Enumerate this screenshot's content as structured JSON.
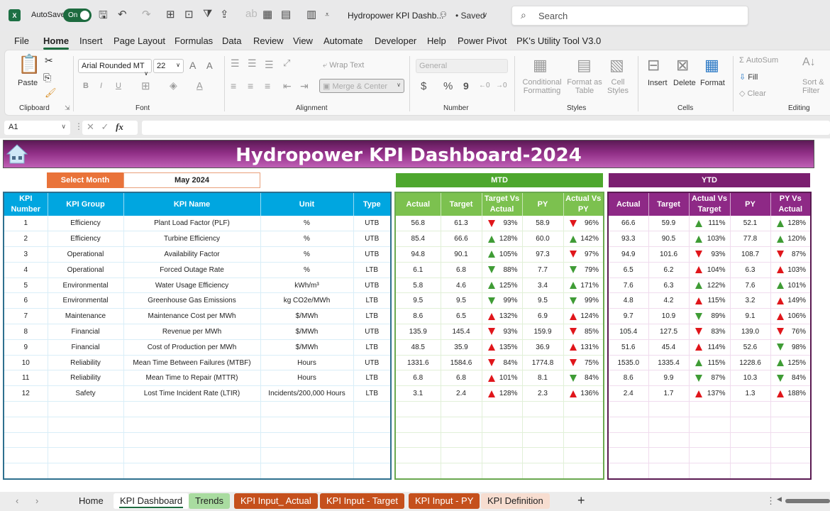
{
  "titlebar": {
    "app_icon": "excel-icon",
    "autosave_label": "AutoSave",
    "autosave_state": "On",
    "doc_title": "Hydropower KPI Dashb...",
    "saved_status": "• Saved",
    "search_placeholder": "Search"
  },
  "menu": [
    "File",
    "Home",
    "Insert",
    "Page Layout",
    "Formulas",
    "Data",
    "Review",
    "View",
    "Automate",
    "Developer",
    "Help",
    "Power Pivot",
    "PK's Utility Tool V3.0"
  ],
  "menu_active": "Home",
  "ribbon": {
    "clipboard": {
      "paste": "Paste",
      "label": "Clipboard"
    },
    "font": {
      "name": "Arial Rounded MT",
      "size": "22",
      "bold": "B",
      "italic": "I",
      "underline": "U",
      "label": "Font"
    },
    "alignment": {
      "wrap": "Wrap Text",
      "merge": "Merge & Center",
      "label": "Alignment"
    },
    "number": {
      "format": "General",
      "currency": "$",
      "percent": "%",
      "comma": "9",
      "label": "Number"
    },
    "styles": {
      "conditional": "Conditional",
      "conditional2": "Formatting",
      "format_table": "Format as",
      "format_table2": "Table",
      "cell_styles": "Cell",
      "cell_styles2": "Styles",
      "label": "Styles"
    },
    "cells": {
      "insert": "Insert",
      "delete": "Delete",
      "format": "Format",
      "label": "Cells"
    },
    "editing": {
      "autosum": "AutoSum",
      "fill": "Fill",
      "clear": "Clear",
      "sort": "Sort &",
      "sort2": "Filter",
      "label": "Editing"
    }
  },
  "formula_bar": {
    "name_box": "A1",
    "fx": "fx",
    "value": ""
  },
  "dashboard": {
    "title": "Hydropower KPI Dashboard-2024",
    "select_month_label": "Select Month",
    "select_month_value": "May 2024",
    "mtd_label": "MTD",
    "ytd_label": "YTD",
    "kpi_headers": [
      "KPI Number",
      "KPI Group",
      "KPI Name",
      "Unit",
      "Type"
    ],
    "mtd_headers": [
      "Actual",
      "Target",
      "Target Vs Actual",
      "PY",
      "Actual Vs PY"
    ],
    "ytd_headers": [
      "Actual",
      "Target",
      "Actual Vs Target",
      "PY",
      "PY Vs Actual"
    ],
    "colors": {
      "good": "#3f9c35",
      "bad": "#e0161b"
    },
    "rows": [
      {
        "num": "1",
        "group": "Efficiency",
        "name": "Plant Load Factor (PLF)",
        "unit": "%",
        "type": "UTB",
        "mtd": {
          "actual": "56.8",
          "target": "61.3",
          "tva": "93%",
          "tva_dir": "down",
          "tva_status": "bad",
          "py": "58.9",
          "avp": "96%",
          "avp_dir": "down",
          "avp_status": "bad"
        },
        "ytd": {
          "actual": "66.6",
          "target": "59.9",
          "avt": "111%",
          "avt_dir": "up",
          "avt_status": "good",
          "py": "52.1",
          "pva": "128%",
          "pva_dir": "up",
          "pva_status": "good"
        }
      },
      {
        "num": "2",
        "group": "Efficiency",
        "name": "Turbine Efficiency",
        "unit": "%",
        "type": "UTB",
        "mtd": {
          "actual": "85.4",
          "target": "66.6",
          "tva": "128%",
          "tva_dir": "up",
          "tva_status": "good",
          "py": "60.0",
          "avp": "142%",
          "avp_dir": "up",
          "avp_status": "good"
        },
        "ytd": {
          "actual": "93.3",
          "target": "90.5",
          "avt": "103%",
          "avt_dir": "up",
          "avt_status": "good",
          "py": "77.8",
          "pva": "120%",
          "pva_dir": "up",
          "pva_status": "good"
        }
      },
      {
        "num": "3",
        "group": "Operational",
        "name": "Availability Factor",
        "unit": "%",
        "type": "UTB",
        "mtd": {
          "actual": "94.8",
          "target": "90.1",
          "tva": "105%",
          "tva_dir": "up",
          "tva_status": "good",
          "py": "97.3",
          "avp": "97%",
          "avp_dir": "down",
          "avp_status": "bad"
        },
        "ytd": {
          "actual": "94.9",
          "target": "101.6",
          "avt": "93%",
          "avt_dir": "down",
          "avt_status": "bad",
          "py": "108.7",
          "pva": "87%",
          "pva_dir": "down",
          "pva_status": "bad"
        }
      },
      {
        "num": "4",
        "group": "Operational",
        "name": "Forced Outage Rate",
        "unit": "%",
        "type": "LTB",
        "mtd": {
          "actual": "6.1",
          "target": "6.8",
          "tva": "88%",
          "tva_dir": "down",
          "tva_status": "good",
          "py": "7.7",
          "avp": "79%",
          "avp_dir": "down",
          "avp_status": "good"
        },
        "ytd": {
          "actual": "6.5",
          "target": "6.2",
          "avt": "104%",
          "avt_dir": "up",
          "avt_status": "bad",
          "py": "6.3",
          "pva": "103%",
          "pva_dir": "up",
          "pva_status": "bad"
        }
      },
      {
        "num": "5",
        "group": "Environmental",
        "name": "Water Usage Efficiency",
        "unit": "kWh/m³",
        "type": "UTB",
        "mtd": {
          "actual": "5.8",
          "target": "4.6",
          "tva": "125%",
          "tva_dir": "up",
          "tva_status": "good",
          "py": "3.4",
          "avp": "171%",
          "avp_dir": "up",
          "avp_status": "good"
        },
        "ytd": {
          "actual": "7.6",
          "target": "6.3",
          "avt": "122%",
          "avt_dir": "up",
          "avt_status": "good",
          "py": "7.6",
          "pva": "101%",
          "pva_dir": "up",
          "pva_status": "good"
        }
      },
      {
        "num": "6",
        "group": "Environmental",
        "name": "Greenhouse Gas Emissions",
        "unit": "kg CO2e/MWh",
        "type": "LTB",
        "mtd": {
          "actual": "9.5",
          "target": "9.5",
          "tva": "99%",
          "tva_dir": "down",
          "tva_status": "good",
          "py": "9.5",
          "avp": "99%",
          "avp_dir": "down",
          "avp_status": "good"
        },
        "ytd": {
          "actual": "4.8",
          "target": "4.2",
          "avt": "115%",
          "avt_dir": "up",
          "avt_status": "bad",
          "py": "3.2",
          "pva": "149%",
          "pva_dir": "up",
          "pva_status": "bad"
        }
      },
      {
        "num": "7",
        "group": "Maintenance",
        "name": "Maintenance Cost per MWh",
        "unit": "$/MWh",
        "type": "LTB",
        "mtd": {
          "actual": "8.6",
          "target": "6.5",
          "tva": "132%",
          "tva_dir": "up",
          "tva_status": "bad",
          "py": "6.9",
          "avp": "124%",
          "avp_dir": "up",
          "avp_status": "bad"
        },
        "ytd": {
          "actual": "9.7",
          "target": "10.9",
          "avt": "89%",
          "avt_dir": "down",
          "avt_status": "good",
          "py": "9.1",
          "pva": "106%",
          "pva_dir": "up",
          "pva_status": "bad"
        }
      },
      {
        "num": "8",
        "group": "Financial",
        "name": "Revenue per MWh",
        "unit": "$/MWh",
        "type": "UTB",
        "mtd": {
          "actual": "135.9",
          "target": "145.4",
          "tva": "93%",
          "tva_dir": "down",
          "tva_status": "bad",
          "py": "159.9",
          "avp": "85%",
          "avp_dir": "down",
          "avp_status": "bad"
        },
        "ytd": {
          "actual": "105.4",
          "target": "127.5",
          "avt": "83%",
          "avt_dir": "down",
          "avt_status": "bad",
          "py": "139.0",
          "pva": "76%",
          "pva_dir": "down",
          "pva_status": "bad"
        }
      },
      {
        "num": "9",
        "group": "Financial",
        "name": "Cost of Production per MWh",
        "unit": "$/MWh",
        "type": "LTB",
        "mtd": {
          "actual": "48.5",
          "target": "35.9",
          "tva": "135%",
          "tva_dir": "up",
          "tva_status": "bad",
          "py": "36.9",
          "avp": "131%",
          "avp_dir": "up",
          "avp_status": "bad"
        },
        "ytd": {
          "actual": "51.6",
          "target": "45.4",
          "avt": "114%",
          "avt_dir": "up",
          "avt_status": "bad",
          "py": "52.6",
          "pva": "98%",
          "pva_dir": "down",
          "pva_status": "good"
        }
      },
      {
        "num": "10",
        "group": "Reliability",
        "name": "Mean Time Between Failures (MTBF)",
        "unit": "Hours",
        "type": "UTB",
        "mtd": {
          "actual": "1331.6",
          "target": "1584.6",
          "tva": "84%",
          "tva_dir": "down",
          "tva_status": "bad",
          "py": "1774.8",
          "avp": "75%",
          "avp_dir": "down",
          "avp_status": "bad"
        },
        "ytd": {
          "actual": "1535.0",
          "target": "1335.4",
          "avt": "115%",
          "avt_dir": "up",
          "avt_status": "good",
          "py": "1228.6",
          "pva": "125%",
          "pva_dir": "up",
          "pva_status": "good"
        }
      },
      {
        "num": "11",
        "group": "Reliability",
        "name": "Mean Time to Repair (MTTR)",
        "unit": "Hours",
        "type": "LTB",
        "mtd": {
          "actual": "6.8",
          "target": "6.8",
          "tva": "101%",
          "tva_dir": "up",
          "tva_status": "bad",
          "py": "8.1",
          "avp": "84%",
          "avp_dir": "down",
          "avp_status": "good"
        },
        "ytd": {
          "actual": "8.6",
          "target": "9.9",
          "avt": "87%",
          "avt_dir": "down",
          "avt_status": "good",
          "py": "10.3",
          "pva": "84%",
          "pva_dir": "down",
          "pva_status": "good"
        }
      },
      {
        "num": "12",
        "group": "Safety",
        "name": "Lost Time Incident Rate (LTIR)",
        "unit": "Incidents/200,000 Hours",
        "type": "LTB",
        "mtd": {
          "actual": "3.1",
          "target": "2.4",
          "tva": "128%",
          "tva_dir": "up",
          "tva_status": "bad",
          "py": "2.3",
          "avp": "136%",
          "avp_dir": "up",
          "avp_status": "bad"
        },
        "ytd": {
          "actual": "2.4",
          "target": "1.7",
          "avt": "137%",
          "avt_dir": "up",
          "avt_status": "bad",
          "py": "1.3",
          "pva": "188%",
          "pva_dir": "up",
          "pva_status": "bad"
        }
      }
    ]
  },
  "sheet_tabs": [
    {
      "label": "Home",
      "bg": "transparent",
      "color": "#222"
    },
    {
      "label": "KPI Dashboard",
      "bg": "#ffffff",
      "color": "#222",
      "active": true
    },
    {
      "label": "Trends",
      "bg": "#a9dca0",
      "color": "#222"
    },
    {
      "label": "KPI Input_ Actual",
      "bg": "#c5501c",
      "color": "#ffffff"
    },
    {
      "label": "KPI Input - Target",
      "bg": "#c5501c",
      "color": "#ffffff"
    },
    {
      "label": "KPI Input - PY",
      "bg": "#c5501c",
      "color": "#ffffff"
    },
    {
      "label": "KPI Definition",
      "bg": "#f7ddd0",
      "color": "#222"
    }
  ],
  "add_sheet": "+"
}
